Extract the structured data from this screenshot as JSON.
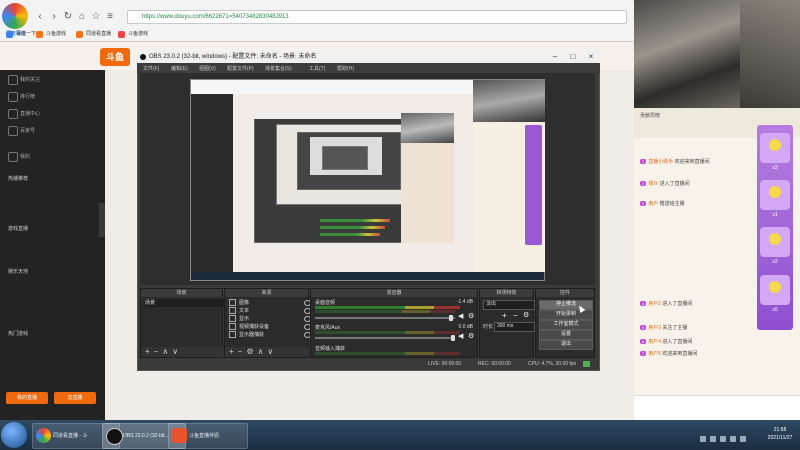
{
  "browser": {
    "logo_label": "百度输给",
    "url": "https://www.douyu.com/6622671=5407348283048J913",
    "bookmarks": [
      "百度一下",
      "斗鱼游戏",
      "同道看直播",
      "斗鱼游戏"
    ]
  },
  "douyu": {
    "logo": "斗鱼",
    "sidebar": [
      "我的关注",
      "排行榜",
      "直播中心",
      "百家号",
      "我的"
    ],
    "sidebar_sections": [
      "热播推荐",
      "游戏直播",
      "娱乐天地",
      "热门游戏"
    ],
    "buttons": [
      "我的直播",
      "去直播"
    ]
  },
  "chat": {
    "header": "贡献周榜",
    "lines": [
      {
        "name": "直播小助手",
        "text": "欢迎来到直播间"
      },
      {
        "name": "观众",
        "text": "进入了直播间"
      },
      {
        "name": "用户",
        "text": "赠送给主播"
      },
      {
        "name": "用户2",
        "text": "进入了直播间"
      },
      {
        "name": "用户3",
        "text": "关注了主播"
      },
      {
        "name": "用户4",
        "text": "进入了直播间"
      },
      {
        "name": "用户5",
        "text": "欢迎来到直播间"
      }
    ],
    "gift_counts": [
      "x3",
      "x1",
      "x2",
      "x5"
    ]
  },
  "obs": {
    "title": "OBS 23.0.2 (32-bit, windows) - 配置文件: 未命名 - 场景: 未命名",
    "menu": [
      "文件(F)",
      "编辑(E)",
      "视图(V)",
      "配置文件(P)",
      "场景集合(S)",
      "工具(T)",
      "帮助(H)"
    ],
    "docks": {
      "scenes": {
        "title": "场景",
        "items": [
          "场景"
        ]
      },
      "sources": {
        "title": "来源",
        "items": [
          "图像",
          "文本",
          "显示",
          "视频捕获设备",
          "显示器捕获"
        ]
      },
      "mixer": {
        "title": "混音器",
        "tracks": [
          {
            "name": "桌面音频",
            "db": "-1.4 dB"
          },
          {
            "name": "麦克风/Aux",
            "db": "0.0 dB"
          },
          {
            "name": "音频输入捕获",
            "db": "0.0 dB"
          }
        ]
      },
      "transitions": {
        "title": "转场特效",
        "type": "淡出",
        "duration_label": "时长",
        "duration": "300 ms"
      },
      "controls": {
        "title": "控件",
        "buttons": [
          "停止推流",
          "开始录制",
          "工作室模式",
          "设置",
          "退出"
        ]
      }
    },
    "status": {
      "live": "LIVE: 00:00:00",
      "rec": "REC: 00:00:00",
      "cpu": "CPU: 4.7%, 30.00 fps"
    }
  },
  "taskbar": {
    "tasks": [
      "同道看直播 - 斗",
      "OBS 23.0.2 (32-bit...",
      "斗鱼直播伴侣"
    ],
    "time": "21:58",
    "date": "2021/11/27"
  }
}
